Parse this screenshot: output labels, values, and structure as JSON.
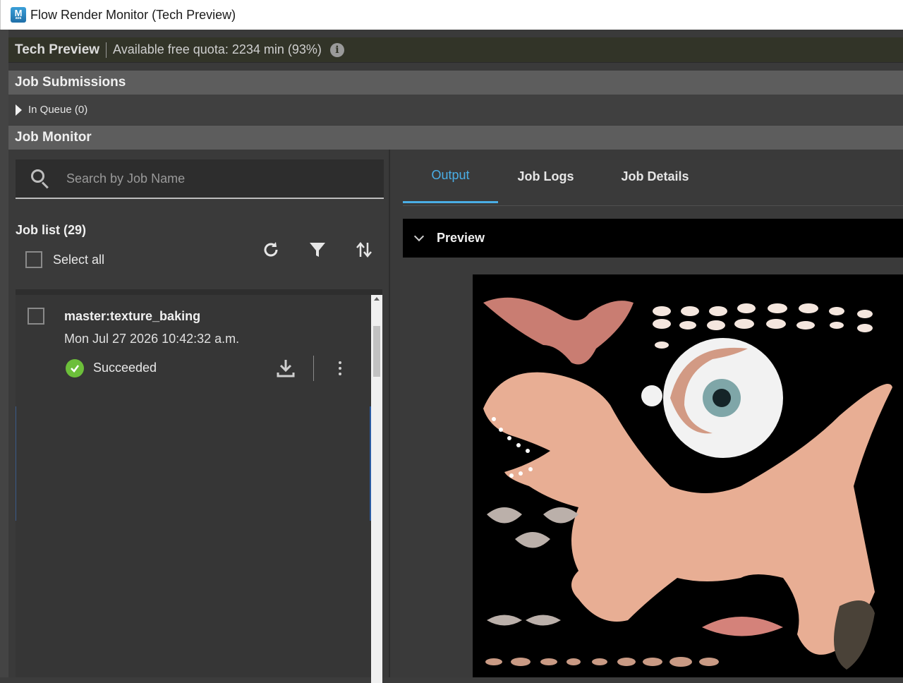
{
  "window": {
    "title": "Flow Render Monitor (Tech Preview)",
    "app_icon_letter": "M",
    "app_icon_sub": "ava"
  },
  "quota": {
    "badge": "Tech Preview",
    "text": "Available free quota: 2234 min (93%)",
    "info_glyph": "i"
  },
  "job_submissions": {
    "title": "Job Submissions",
    "queue_label": "In Queue (0)"
  },
  "job_monitor": {
    "title": "Job Monitor",
    "search": {
      "placeholder": "Search by Job Name"
    },
    "list_title": "Job list (29)",
    "select_all_label": "Select all",
    "toolbar": {
      "refresh_icon": "refresh-icon",
      "filter_icon": "filter-icon",
      "sort_icon": "sort-icon"
    },
    "jobs": [
      {
        "name": "master:texture_baking",
        "date": "Mon Jul 27 2026 10:42:32 a.m.",
        "status": "Succeeded",
        "status_color": "#6cbf3a"
      }
    ]
  },
  "detail": {
    "tabs": [
      {
        "label": "Output",
        "active": true
      },
      {
        "label": "Job Logs",
        "active": false
      },
      {
        "label": "Job Details",
        "active": false
      }
    ],
    "preview_label": "Preview",
    "accent_color": "#4aaee6"
  }
}
